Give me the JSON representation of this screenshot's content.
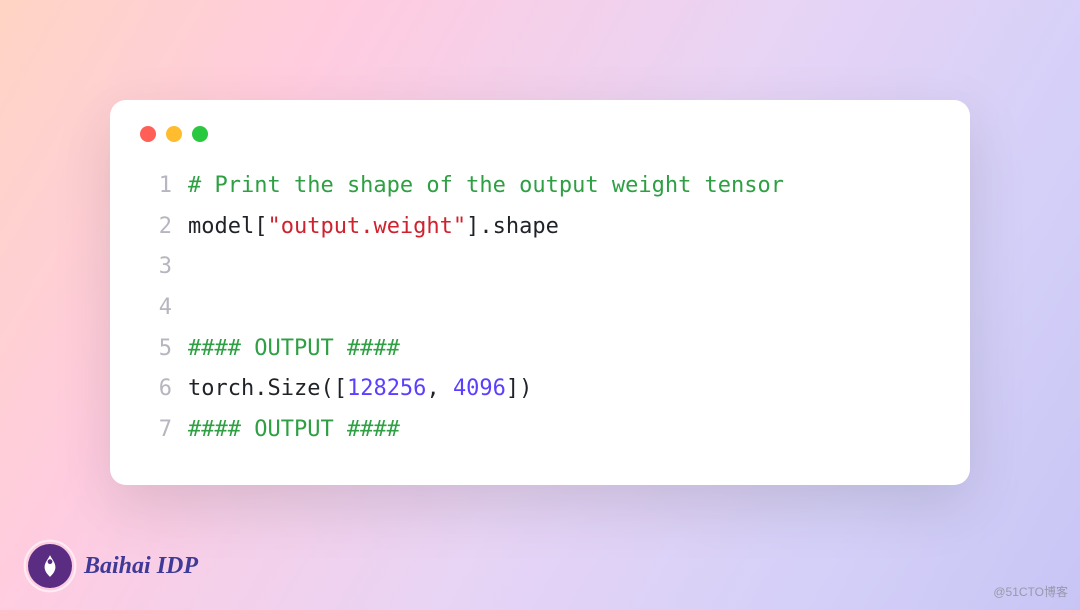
{
  "code": {
    "lines": [
      {
        "n": "1",
        "tokens": [
          {
            "cls": "c-comment",
            "t": "# Print the shape of the output weight tensor"
          }
        ]
      },
      {
        "n": "2",
        "tokens": [
          {
            "cls": "c-default",
            "t": "model["
          },
          {
            "cls": "c-string",
            "t": "\"output.weight\""
          },
          {
            "cls": "c-default",
            "t": "].shape"
          }
        ]
      },
      {
        "n": "3",
        "tokens": [
          {
            "cls": "c-default",
            "t": " "
          }
        ]
      },
      {
        "n": "4",
        "tokens": [
          {
            "cls": "c-default",
            "t": " "
          }
        ]
      },
      {
        "n": "5",
        "tokens": [
          {
            "cls": "c-comment",
            "t": "#### OUTPUT ####"
          }
        ]
      },
      {
        "n": "6",
        "tokens": [
          {
            "cls": "c-default",
            "t": "torch.Size(["
          },
          {
            "cls": "c-number",
            "t": "128256"
          },
          {
            "cls": "c-default",
            "t": ", "
          },
          {
            "cls": "c-number",
            "t": "4096"
          },
          {
            "cls": "c-default",
            "t": "])"
          }
        ]
      },
      {
        "n": "7",
        "tokens": [
          {
            "cls": "c-comment",
            "t": "#### OUTPUT ####"
          }
        ]
      }
    ]
  },
  "brand": {
    "name": "Baihai IDP"
  },
  "watermark": {
    "text": "@51CTO博客"
  },
  "colors": {
    "comment": "#2ea043",
    "string": "#cf222e",
    "number": "#5a3fff",
    "default": "#1f2328",
    "lineNumber": "#b6b6c0",
    "brandPurple": "#5a2d82",
    "brandTextIndigo": "#3f3a97"
  }
}
